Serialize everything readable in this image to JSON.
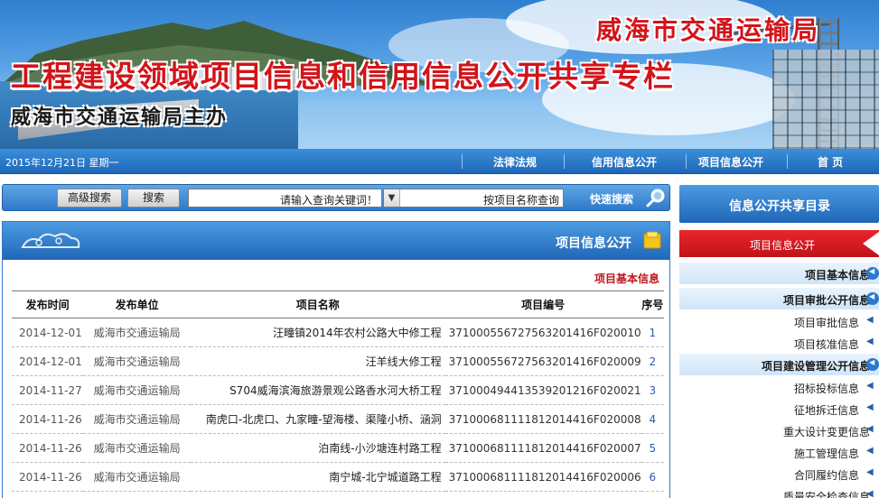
{
  "banner": {
    "agency": "威海市交通运输局",
    "title": "工程建设领域项目信息和信用信息公开共享专栏",
    "host": "威海市交通运输局主办"
  },
  "nav": {
    "date": "2015年12月21日 星期一",
    "items": [
      "首 页",
      "项目信息公开",
      "信用信息公开",
      "法律法规"
    ]
  },
  "search": {
    "quick_label": "快速搜索",
    "select_value": "按项目名称查询",
    "input_value": "请输入查询关键词！",
    "search_button": "搜索",
    "advanced_button": "高级搜索"
  },
  "panel": {
    "title": "项目信息公开",
    "section": "项目基本信息",
    "columns": [
      "序号",
      "项目编号",
      "项目名称",
      "发布单位",
      "发布时间"
    ],
    "rows": [
      {
        "idx": "1",
        "code": "371000556727563201416F020010",
        "name": "汪疃镇2014年农村公路大中修工程",
        "unit": "威海市交通运输局",
        "date": "2014-12-01"
      },
      {
        "idx": "2",
        "code": "371000556727563201416F020009",
        "name": "汪羊线大修工程",
        "unit": "威海市交通运输局",
        "date": "2014-12-01"
      },
      {
        "idx": "3",
        "code": "371000494413539201216F020021",
        "name": "S704威海滨海旅游景观公路香水河大桥工程",
        "unit": "威海市交通运输局",
        "date": "2014-11-27"
      },
      {
        "idx": "4",
        "code": "371000681111812014416F020008",
        "name": "南虎口-北虎口、九家疃-望海楼、渠隆小桥、涵洞",
        "unit": "威海市交通运输局",
        "date": "2014-11-26"
      },
      {
        "idx": "5",
        "code": "371000681111812014416F020007",
        "name": "泊南线-小沙塘连村路工程",
        "unit": "威海市交通运输局",
        "date": "2014-11-26"
      },
      {
        "idx": "6",
        "code": "371000681111812014416F020006",
        "name": "南宁城-北宁城道路工程",
        "unit": "威海市交通运输局",
        "date": "2014-11-26"
      }
    ]
  },
  "sidebar": {
    "title": "信息公开共享目录",
    "active": "项目信息公开",
    "categories": [
      {
        "label": "项目基本信息",
        "items": []
      },
      {
        "label": "项目审批公开信息",
        "items": [
          "项目审批信息",
          "项目核准信息"
        ]
      },
      {
        "label": "项目建设管理公开信息",
        "items": [
          "招标投标信息",
          "征地拆迁信息",
          "重大设计变更信息",
          "施工管理信息",
          "合同履约信息",
          "质量安全检查信息"
        ]
      }
    ]
  },
  "colors": {
    "brand_blue": "#1f66b8",
    "accent_red": "#d2141b"
  }
}
